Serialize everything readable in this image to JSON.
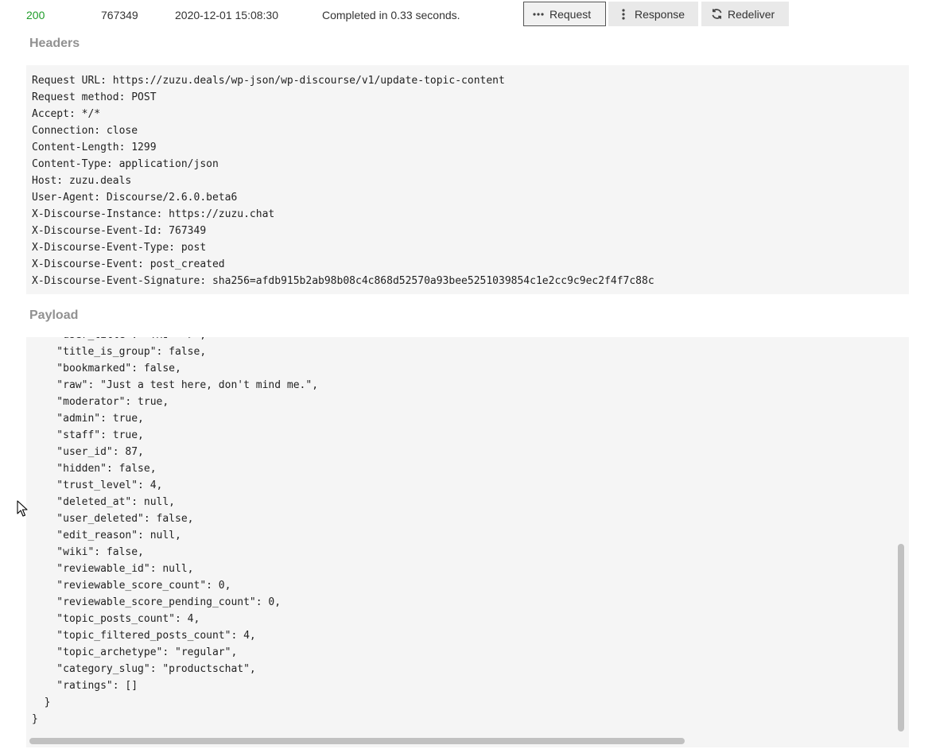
{
  "summary": {
    "status_code": "200",
    "event_id": "767349",
    "timestamp": "2020-12-01 15:08:30",
    "completed_text": "Completed in 0.33 seconds."
  },
  "buttons": {
    "request": {
      "label": "Request",
      "icon": "ellipsis-icon",
      "active": true
    },
    "response": {
      "label": "Response",
      "icon": "vertical-ellipsis-icon"
    },
    "redeliver": {
      "label": "Redeliver",
      "icon": "refresh-icon"
    }
  },
  "headers": {
    "title": "Headers",
    "lines": [
      "Request URL: https://zuzu.deals/wp-json/wp-discourse/v1/update-topic-content",
      "Request method: POST",
      "Accept: */*",
      "Connection: close",
      "Content-Length: 1299",
      "Content-Type: application/json",
      "Host: zuzu.deals",
      "User-Agent: Discourse/2.6.0.beta6",
      "X-Discourse-Instance: https://zuzu.chat",
      "X-Discourse-Event-Id: 767349",
      "X-Discourse-Event-Type: post",
      "X-Discourse-Event: post_created",
      "X-Discourse-Event-Signature: sha256=afdb915b2ab98b08c4c868d52570a93bee5251039854c1e2cc9c9ec2f4f7c88c"
    ]
  },
  "payload": {
    "title": "Payload",
    "lines": [
      "    \"user_title\": \"ל > נחו\",",
      "    \"title_is_group\": false,",
      "    \"bookmarked\": false,",
      "    \"raw\": \"Just a test here, don't mind me.\",",
      "    \"moderator\": true,",
      "    \"admin\": true,",
      "    \"staff\": true,",
      "    \"user_id\": 87,",
      "    \"hidden\": false,",
      "    \"trust_level\": 4,",
      "    \"deleted_at\": null,",
      "    \"user_deleted\": false,",
      "    \"edit_reason\": null,",
      "    \"wiki\": false,",
      "    \"reviewable_id\": null,",
      "    \"reviewable_score_count\": 0,",
      "    \"reviewable_score_pending_count\": 0,",
      "    \"topic_posts_count\": 4,",
      "    \"topic_filtered_posts_count\": 4,",
      "    \"topic_archetype\": \"regular\",",
      "    \"category_slug\": \"productschat\",",
      "    \"ratings\": []",
      "  }",
      "}"
    ]
  },
  "colors": {
    "status_ok": "#1e9c28",
    "section_title": "#919191",
    "code_bg": "#f5f5f5"
  }
}
